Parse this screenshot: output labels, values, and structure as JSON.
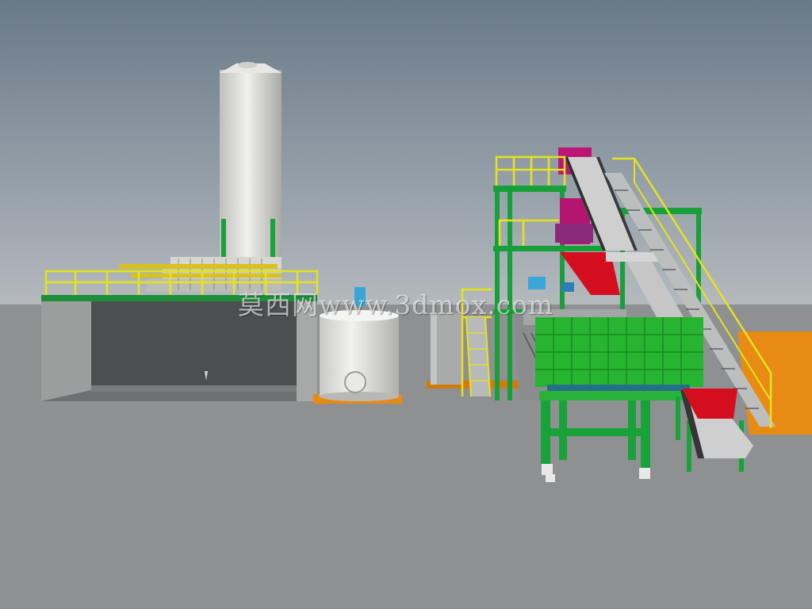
{
  "watermark": {
    "text": "莫西网www.3dmox.com"
  },
  "colors": {
    "sky_top": "#657584",
    "sky_bottom": "#b6bcc1",
    "ground": "#909192",
    "silo": "#dcdcd8",
    "steel_green": "#15a23b",
    "railing_yellow": "#e5e51a",
    "crusher_magenta": "#c0157a",
    "hopper_red": "#d8101e",
    "ground_pad_orange": "#e98b12",
    "screen_green": "#27b531",
    "conveyor_belt": "#c5c5c5",
    "pump_blue": "#3ba7d8"
  },
  "icons": [
    "silo",
    "tank",
    "pit",
    "filter-press",
    "belt-conveyor",
    "crusher",
    "vibrating-screen",
    "steel-platform"
  ]
}
